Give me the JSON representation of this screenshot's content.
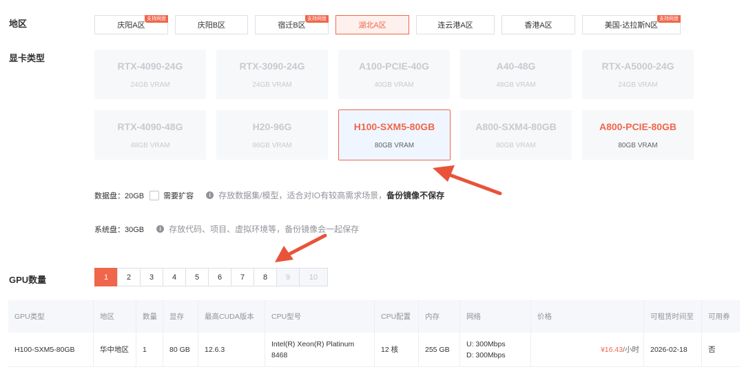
{
  "region": {
    "label": "地区",
    "items": [
      {
        "label": "庆阳A区",
        "badge": "支持网盘",
        "active": false
      },
      {
        "label": "庆阳B区",
        "badge": "",
        "active": false
      },
      {
        "label": "宿迁B区",
        "badge": "支持网盘",
        "active": false
      },
      {
        "label": "湖北A区",
        "badge": "",
        "active": true
      },
      {
        "label": "连云港A区",
        "badge": "",
        "active": false
      },
      {
        "label": "香港A区",
        "badge": "",
        "active": false
      },
      {
        "label": "美国-达拉斯N区",
        "badge": "支持网盘",
        "active": false
      }
    ]
  },
  "gpu_type": {
    "label": "显卡类型",
    "cards": [
      {
        "name": "RTX-4090-24G",
        "vram": "24GB VRAM",
        "state": "disabled"
      },
      {
        "name": "RTX-3090-24G",
        "vram": "24GB VRAM",
        "state": "disabled"
      },
      {
        "name": "A100-PCIE-40G",
        "vram": "40GB VRAM",
        "state": "disabled"
      },
      {
        "name": "A40-48G",
        "vram": "48GB VRAM",
        "state": "disabled"
      },
      {
        "name": "RTX-A5000-24G",
        "vram": "24GB VRAM",
        "state": "disabled"
      },
      {
        "name": "RTX-4090-48G",
        "vram": "48GB VRAM",
        "state": "disabled"
      },
      {
        "name": "H20-96G",
        "vram": "96GB VRAM",
        "state": "disabled"
      },
      {
        "name": "H100-SXM5-80GB",
        "vram": "80GB VRAM",
        "state": "selected"
      },
      {
        "name": "A800-SXM4-80GB",
        "vram": "80GB VRAM",
        "state": "disabled"
      },
      {
        "name": "A800-PCIE-80GB",
        "vram": "80GB VRAM",
        "state": "available"
      }
    ]
  },
  "data_disk": {
    "label": "数据盘：20GB",
    "expand_label": "需要扩容",
    "hint": "存放数据集/模型，适合对IO有较高需求场景，",
    "hint_strong": "备份镜像不保存"
  },
  "system_disk": {
    "label": "系统盘：30GB",
    "hint": "存放代码、项目、虚拟环境等，备份镜像会一起保存"
  },
  "gpu_count": {
    "label": "GPU数量",
    "options": [
      {
        "value": "1",
        "state": "active"
      },
      {
        "value": "2",
        "state": "normal"
      },
      {
        "value": "3",
        "state": "normal"
      },
      {
        "value": "4",
        "state": "normal"
      },
      {
        "value": "5",
        "state": "normal"
      },
      {
        "value": "6",
        "state": "normal"
      },
      {
        "value": "7",
        "state": "normal"
      },
      {
        "value": "8",
        "state": "normal"
      },
      {
        "value": "9",
        "state": "disabled"
      },
      {
        "value": "10",
        "state": "disabled"
      }
    ]
  },
  "table": {
    "headers": [
      "GPU类型",
      "地区",
      "数量",
      "显存",
      "最高CUDA版本",
      "CPU型号",
      "CPU配置",
      "内存",
      "网络",
      "价格",
      "可租赁时间至",
      "可用券"
    ],
    "row": {
      "gpu_type": "H100-SXM5-80GB",
      "region": "华中地区",
      "count": "1",
      "vram": "80 GB",
      "cuda": "12.6.3",
      "cpu_model": "Intel(R) Xeon(R) Platinum 8468",
      "cpu_config": "12 核",
      "memory": "255 GB",
      "network_up": "U: 300Mbps",
      "network_down": "D: 300Mbps",
      "price": "¥16.43",
      "price_unit": "/小时",
      "rent_until": "2026-02-18",
      "coupon": "否"
    }
  },
  "colors": {
    "accent": "#f0664a",
    "disabled_text": "#c8cacf",
    "card_bg": "#f7f8fa",
    "arrow": "#e8533a"
  }
}
